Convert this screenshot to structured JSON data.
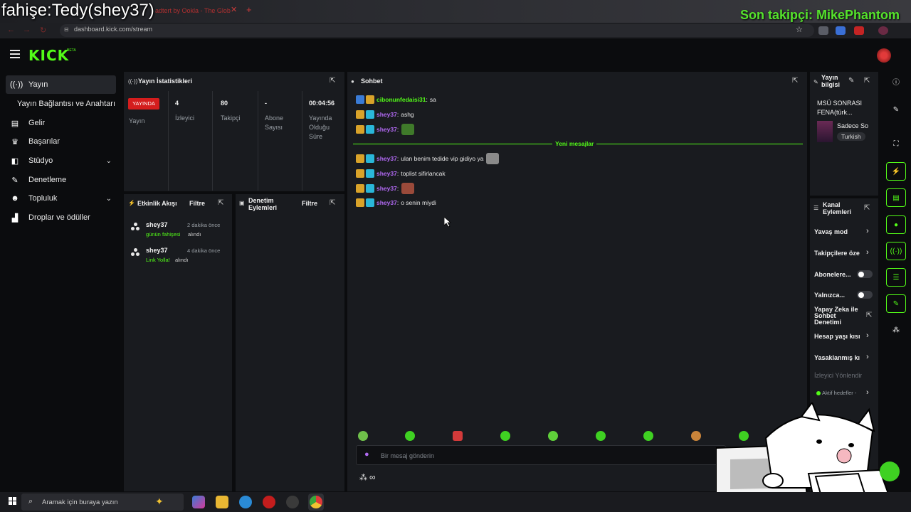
{
  "overlay": {
    "title": "fahişe:Tedy(shey37)",
    "follower": "Son takipçi: MikePhantom"
  },
  "browser": {
    "tab_title": "adtert by Ookla - The Glob",
    "url": "dashboard.kick.com/stream",
    "tab_close": "✕",
    "new_tab": "+"
  },
  "app": {
    "logo": "KICK",
    "logo_beta": "BETA"
  },
  "sidebar": {
    "items": [
      {
        "label": "Yayın",
        "icon": "broadcast-icon"
      },
      {
        "label": "Yayın Bağlantısı ve Anahtarı",
        "icon": ""
      },
      {
        "label": "Gelir",
        "icon": "revenue-icon"
      },
      {
        "label": "Başarılar",
        "icon": "trophy-icon"
      },
      {
        "label": "Stüdyo",
        "icon": "studio-icon"
      },
      {
        "label": "Denetleme",
        "icon": "wrench-icon"
      },
      {
        "label": "Topluluk",
        "icon": "community-icon"
      },
      {
        "label": "Droplar ve ödüller",
        "icon": "drops-icon"
      }
    ]
  },
  "stats": {
    "title": "Yayın İstatistikleri",
    "live_badge": "YAYINDA",
    "live_label": "Yayın",
    "viewers_value": "4",
    "viewers_label": "İzleyici",
    "followers_value": "80",
    "followers_label": "Takipçi",
    "subs_value": "-",
    "subs_label_1": "Abone",
    "subs_label_2": "Sayısı",
    "uptime_value": "00:04:56",
    "uptime_label_1": "Yayında",
    "uptime_label_2": "Olduğu",
    "uptime_label_3": "Süre"
  },
  "events": {
    "title": "Etkinlik Akışı",
    "filter": "Filtre",
    "items": [
      {
        "user": "shey37",
        "time": "2 dakika önce",
        "reward": "günün fahişesi",
        "got": "alındı"
      },
      {
        "user": "shey37",
        "time": "4 dakika önce",
        "reward": "Link Yolla!",
        "got": "alındı"
      }
    ]
  },
  "moderation": {
    "title_1": "Denetim",
    "title_2": "Eylemleri",
    "filter": "Filtre"
  },
  "chat": {
    "title": "Sohbet",
    "new_messages": "Yeni mesajlar",
    "messages": [
      {
        "user": "cibonunfedaisi31",
        "sep": ":",
        "msg": "sa",
        "color": "#53fc18",
        "emote": false
      },
      {
        "user": "shey37",
        "sep": ":",
        "msg": "ashg",
        "color": "#b36af5",
        "emote": false
      },
      {
        "user": "shey37",
        "sep": ":",
        "msg": "",
        "color": "#b36af5",
        "emote": true
      },
      {
        "user": "shey37",
        "sep": ":",
        "msg": "ulan benim tedide vip gidiyo ya",
        "color": "#b36af5",
        "emote": true
      },
      {
        "user": "shey37",
        "sep": ":",
        "msg": "toplist sifirlancak",
        "color": "#b36af5",
        "emote": false
      },
      {
        "user": "shey37",
        "sep": ":",
        "msg": "",
        "color": "#b36af5",
        "emote": true
      },
      {
        "user": "shey37",
        "sep": ":",
        "msg": "o senin miydi",
        "color": "#b36af5",
        "emote": false
      }
    ],
    "input_placeholder": "Bir mesaj gönderin",
    "footer_icon": "∞"
  },
  "stream_info": {
    "title_1": "Yayın",
    "title_2": "bilgisi",
    "stream_title_1": "MSÜ SONRASI",
    "stream_title_2": "FENA(türk...",
    "category": "Sadece So",
    "language": "Turkish"
  },
  "channel_actions": {
    "title_1": "Kanal",
    "title_2": "Eylemleri",
    "slow_mode": "Yavaş mod",
    "followers_only": "Takipçilere öze",
    "subs_only": "Abonelere...",
    "emote_only": "Yalnızca...",
    "ai_mod_1": "Yapay Zeka ile",
    "ai_mod_2": "Sohbet",
    "ai_mod_3": "Denetimi",
    "account_age": "Hesap yaşı kısı",
    "banned_words": "Yasaklanmış kı",
    "raid": "İzleyici Yönlendir",
    "active_goals": "Aktif hedefler -"
  },
  "taskbar": {
    "search_placeholder": "Aramak için buraya yazın"
  },
  "colors": {
    "accent": "#53fc18",
    "panel": "#191b1f",
    "live": "#d41d1d",
    "chat_user": "#b36af5"
  }
}
